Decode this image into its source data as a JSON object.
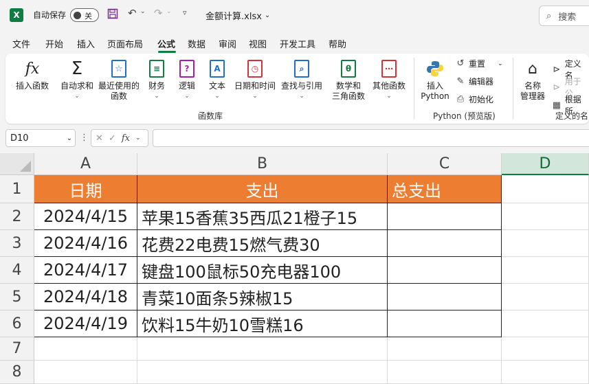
{
  "titlebar": {
    "app_icon": "X",
    "autosave_label": "自动保存",
    "autosave_state": "关",
    "filename": "金额计算.xlsx",
    "search_label": "搜索"
  },
  "menu": {
    "items": [
      "文件",
      "开始",
      "插入",
      "页面布局",
      "公式",
      "数据",
      "审阅",
      "视图",
      "开发工具",
      "帮助"
    ],
    "active": "公式"
  },
  "ribbon": {
    "insert_function": "插入函数",
    "autosum": "自动求和",
    "recent_line1": "最近使用的",
    "recent_line2": "函数",
    "financial": "财务",
    "logical": "逻辑",
    "text": "文本",
    "datetime": "日期和时间",
    "lookup": "查找与引用",
    "math_line1": "数学和",
    "math_line2": "三角函数",
    "more": "其他函数",
    "group_function_library": "函数库",
    "insert_python_line1": "插入",
    "insert_python_line2": "Python",
    "reset": "重置",
    "editor": "编辑器",
    "initialize": "初始化",
    "group_python": "Python (预览版)",
    "name_manager_line1": "名称",
    "name_manager_line2": "管理器",
    "define_name": "定义名",
    "use_in_formula": "用于公",
    "create_from_selection": "根据所",
    "group_defined_names": "定义的名"
  },
  "formula_bar": {
    "name_box": "D10",
    "fx_label": "fx",
    "formula": ""
  },
  "sheet": {
    "columns": [
      "A",
      "B",
      "C",
      "D"
    ],
    "selected_column": "D",
    "rows": [
      "1",
      "2",
      "3",
      "4",
      "5",
      "6",
      "7",
      "8"
    ],
    "header_fill": "#ED7D31",
    "headers": [
      "日期",
      "支出",
      "总支出"
    ],
    "data": [
      [
        "2024/4/15",
        "苹果15香蕉35西瓜21橙子15",
        ""
      ],
      [
        "2024/4/16",
        "花费22电费15燃气费30",
        ""
      ],
      [
        "2024/4/17",
        "键盘100鼠标50充电器100",
        ""
      ],
      [
        "2024/4/18",
        "青菜10面条5辣椒15",
        ""
      ],
      [
        "2024/4/19",
        "饮料15牛奶10雪糕16",
        ""
      ]
    ]
  }
}
